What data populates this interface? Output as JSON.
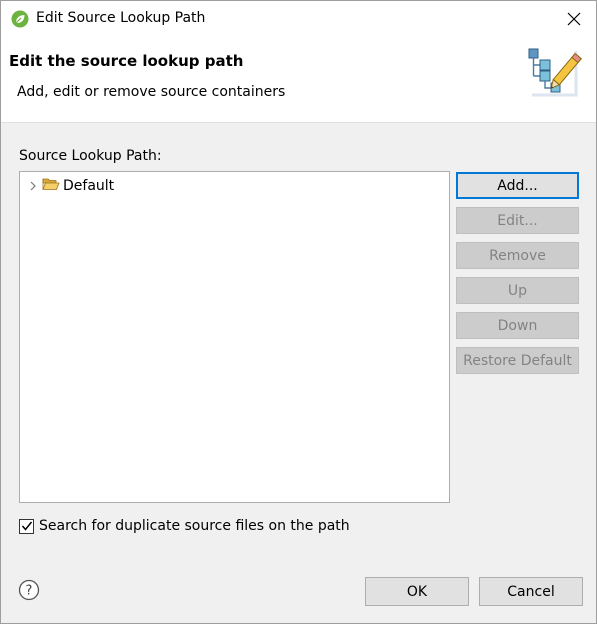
{
  "window": {
    "title": "Edit Source Lookup Path",
    "icon": "spring-leaf-icon"
  },
  "banner": {
    "title": "Edit the source lookup path",
    "message": "Add, edit or remove source containers",
    "icon": "source-lookup-wizard-icon"
  },
  "lookup": {
    "label": "Source Lookup Path:",
    "items": [
      {
        "label": "Default",
        "icon": "folder-icon",
        "expanded": false
      }
    ]
  },
  "buttons": {
    "add": "Add...",
    "edit": "Edit...",
    "remove": "Remove",
    "up": "Up",
    "down": "Down",
    "restore": "Restore Default"
  },
  "duplicates": {
    "label": "Search for duplicate source files on the path",
    "checked": true
  },
  "footer": {
    "ok": "OK",
    "cancel": "Cancel",
    "help_icon": "help-icon"
  },
  "colors": {
    "accent": "#0078d7",
    "disabled_text": "#838383",
    "spring_green": "#6db33f"
  }
}
